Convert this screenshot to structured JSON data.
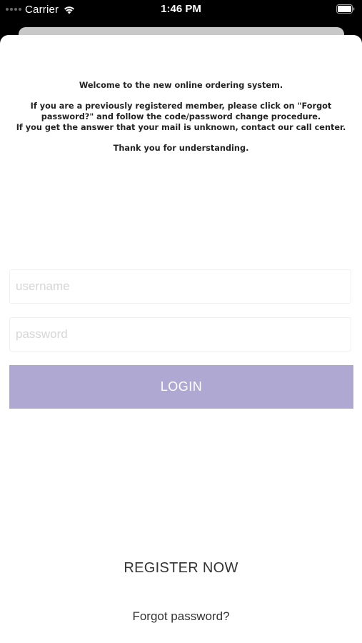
{
  "status_bar": {
    "carrier": "Carrier",
    "time": "1:46 PM",
    "wifi_icon": "wifi-icon",
    "battery_icon": "battery-icon"
  },
  "notice": {
    "welcome": "Welcome to the new online ordering system.",
    "line1": "If you are a previously registered member, please click on \"Forgot",
    "line2": "password?\" and follow the code/password change procedure.",
    "line3": "If you get the answer that your mail is unknown, contact our call center.",
    "thanks": "Thank you for understanding."
  },
  "form": {
    "username_placeholder": "username",
    "username_value": "",
    "password_placeholder": "password",
    "password_value": "",
    "login_label": "LOGIN"
  },
  "links": {
    "register": "REGISTER NOW",
    "forgot": "Forgot password?"
  },
  "colors": {
    "login_button": "#aea8d2",
    "background": "#000000",
    "sheet": "#ffffff"
  }
}
